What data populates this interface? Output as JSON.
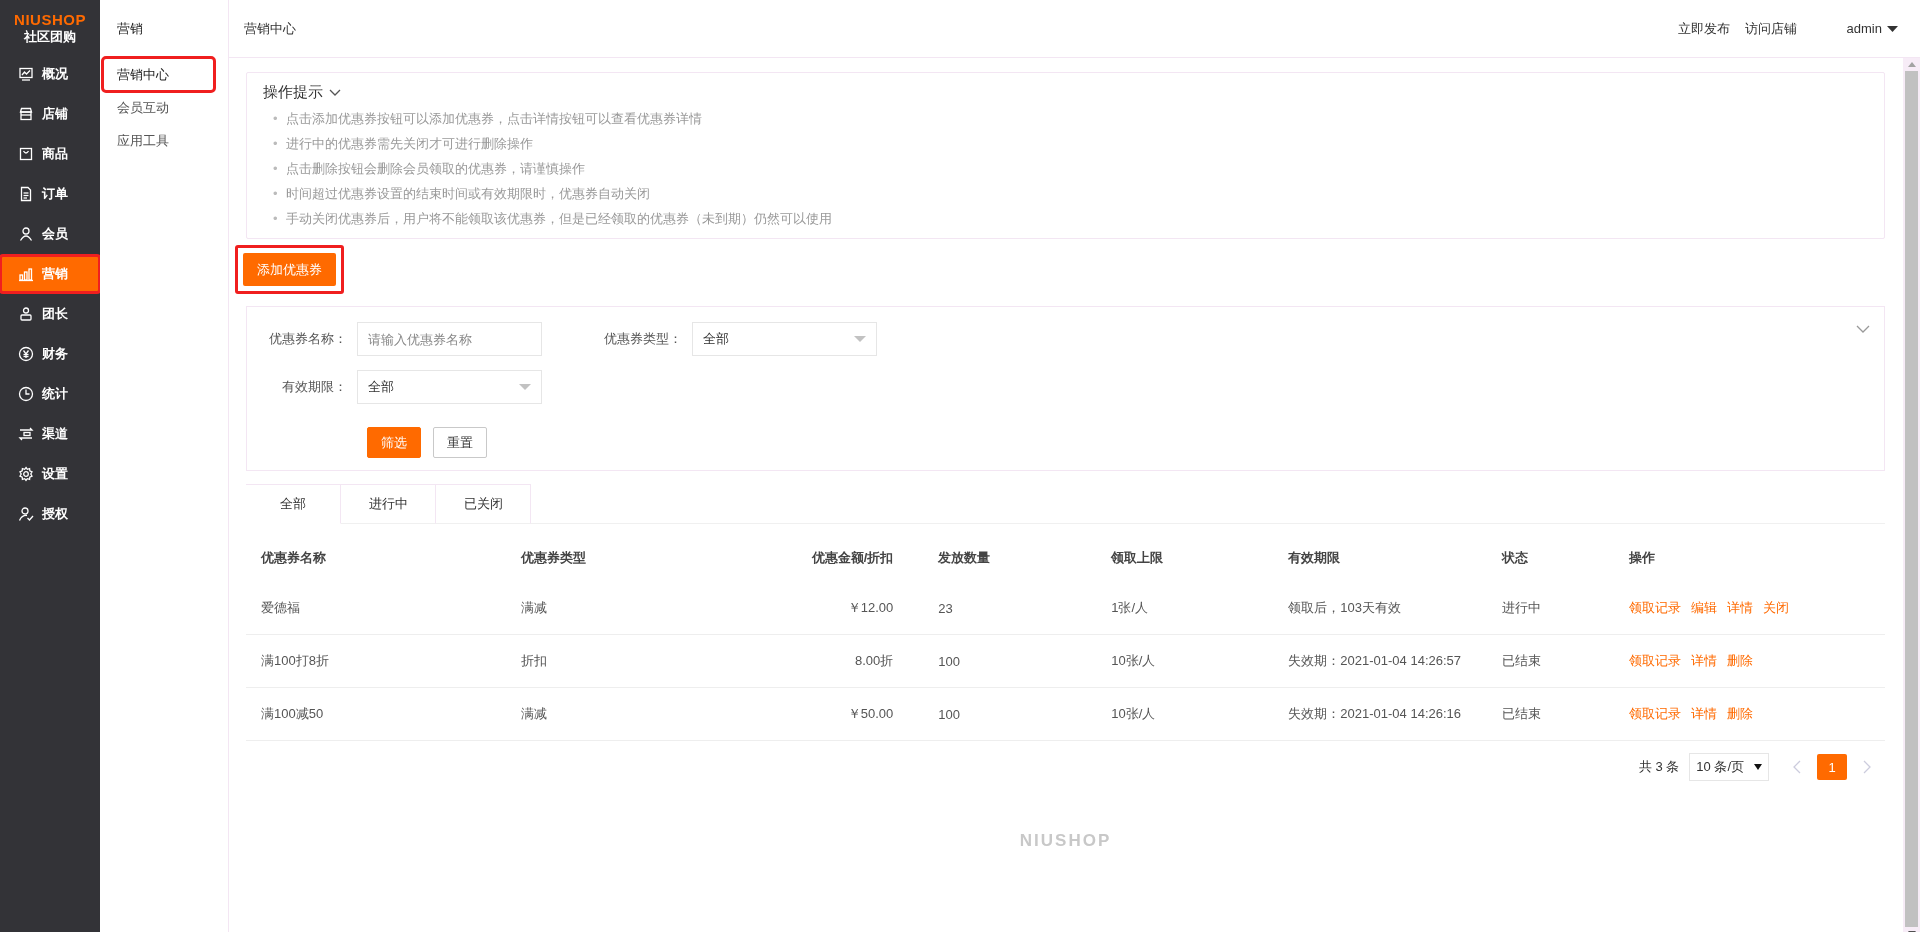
{
  "logo": {
    "brand": "NIUSHOP",
    "subtitle": "社区团购"
  },
  "main_nav": [
    {
      "label": "概况",
      "selected": false,
      "highlighted": false
    },
    {
      "label": "店铺",
      "selected": false,
      "highlighted": false
    },
    {
      "label": "商品",
      "selected": false,
      "highlighted": false
    },
    {
      "label": "订单",
      "selected": false,
      "highlighted": false
    },
    {
      "label": "会员",
      "selected": false,
      "highlighted": false
    },
    {
      "label": "营销",
      "selected": true,
      "highlighted": true
    },
    {
      "label": "团长",
      "selected": false,
      "highlighted": false
    },
    {
      "label": "财务",
      "selected": false,
      "highlighted": false
    },
    {
      "label": "统计",
      "selected": false,
      "highlighted": false
    },
    {
      "label": "渠道",
      "selected": false,
      "highlighted": false
    },
    {
      "label": "设置",
      "selected": false,
      "highlighted": false
    },
    {
      "label": "授权",
      "selected": false,
      "highlighted": false
    }
  ],
  "sub_nav": {
    "title": "营销",
    "items": [
      {
        "label": "营销中心",
        "selected": true,
        "highlighted": true
      },
      {
        "label": "会员互动",
        "selected": false,
        "highlighted": false
      },
      {
        "label": "应用工具",
        "selected": false,
        "highlighted": false
      }
    ]
  },
  "top_bar": {
    "title": "营销中心",
    "links": [
      "立即发布",
      "访问店铺"
    ],
    "user": "admin"
  },
  "tips": {
    "title": "操作提示",
    "bullet": "•",
    "items": [
      "点击添加优惠券按钮可以添加优惠券，点击详情按钮可以查看优惠券详情",
      "进行中的优惠券需先关闭才可进行删除操作",
      "点击删除按钮会删除会员领取的优惠券，请谨慎操作",
      "时间超过优惠券设置的结束时间或有效期限时，优惠券自动关闭",
      "手动关闭优惠券后，用户将不能领取该优惠券，但是已经领取的优惠券（未到期）仍然可以使用"
    ]
  },
  "add_button": {
    "label": "添加优惠券",
    "highlighted": true
  },
  "filter": {
    "fields": [
      {
        "kind": "input",
        "label": "优惠券名称：",
        "placeholder": "请输入优惠券名称"
      },
      {
        "kind": "select",
        "label": "优惠券类型：",
        "value": "全部"
      },
      {
        "kind": "select",
        "label": "有效期限：",
        "value": "全部"
      }
    ],
    "buttons": [
      {
        "kind": "primary",
        "label": "筛选"
      },
      {
        "kind": "default",
        "label": "重置"
      }
    ]
  },
  "tabs": [
    {
      "label": "全部",
      "selected": true
    },
    {
      "label": "进行中",
      "selected": false
    },
    {
      "label": "已关闭",
      "selected": false
    }
  ],
  "table": {
    "columns": [
      "优惠券名称",
      "优惠券类型",
      "优惠金额/折扣",
      "发放数量",
      "领取上限",
      "有效期限",
      "状态",
      "操作"
    ],
    "rows": [
      {
        "cells": [
          "爱德福",
          "满减",
          "￥12.00",
          "23",
          "1张/人",
          "领取后，103天有效",
          "进行中"
        ],
        "actions": [
          "领取记录",
          "编辑",
          "详情",
          "关闭"
        ]
      },
      {
        "cells": [
          "满100打8折",
          "折扣",
          "8.00折",
          "100",
          "10张/人",
          "失效期：2021-01-04 14:26:57",
          "已结束"
        ],
        "actions": [
          "领取记录",
          "详情",
          "删除"
        ]
      },
      {
        "cells": [
          "满100减50",
          "满减",
          "￥50.00",
          "100",
          "10张/人",
          "失效期：2021-01-04 14:26:16",
          "已结束"
        ],
        "actions": [
          "领取记录",
          "详情",
          "删除"
        ]
      }
    ]
  },
  "pagination": {
    "total": "共 3 条",
    "page_size": "10 条/页",
    "pages": [
      {
        "label": "1",
        "selected": true
      }
    ]
  },
  "footer": {
    "brand": "NIUSHOP"
  }
}
